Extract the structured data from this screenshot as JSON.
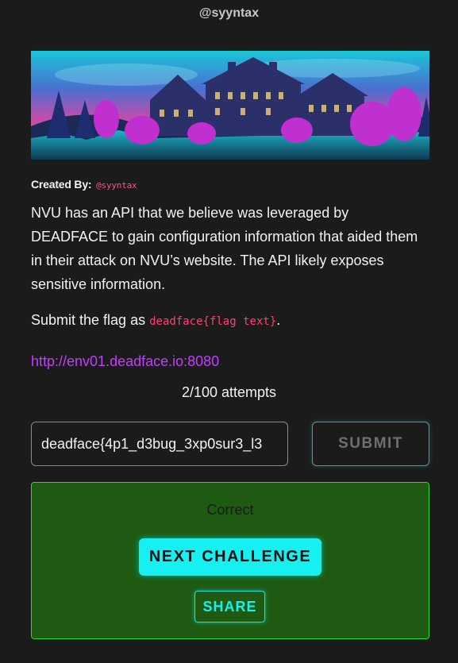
{
  "header": {
    "author": "@syyntax"
  },
  "banner": {
    "icon": "haunted-mansion-image"
  },
  "challenge": {
    "created_by_label": "Created By:",
    "created_by_handle": "@syyntax",
    "description": "NVU has an API that we believe was leveraged by DEADFACE to gain configuration information that aided them in their attack on NVU’s website. The API likely exposes sensitive information.",
    "submit_prefix": "Submit the flag as ",
    "flag_format": "deadface{flag text}",
    "submit_suffix": ".",
    "link": "http://env01.deadface.io:8080",
    "attempts": "2/100 attempts"
  },
  "form": {
    "flag_value": "deadface{4p1_d3bug_3xp0sur3_l3",
    "submit_label": "SUBMIT"
  },
  "result": {
    "status": "Correct",
    "next_label": "NEXT CHALLENGE",
    "share_label": "SHARE"
  },
  "colors": {
    "background": "#1b1b1b",
    "accent_cyan": "#16f0f0",
    "success_border": "#22e02a",
    "success_bg": "#1e5a12",
    "flag_code": "#ff3f74",
    "link": "#c43cff"
  }
}
